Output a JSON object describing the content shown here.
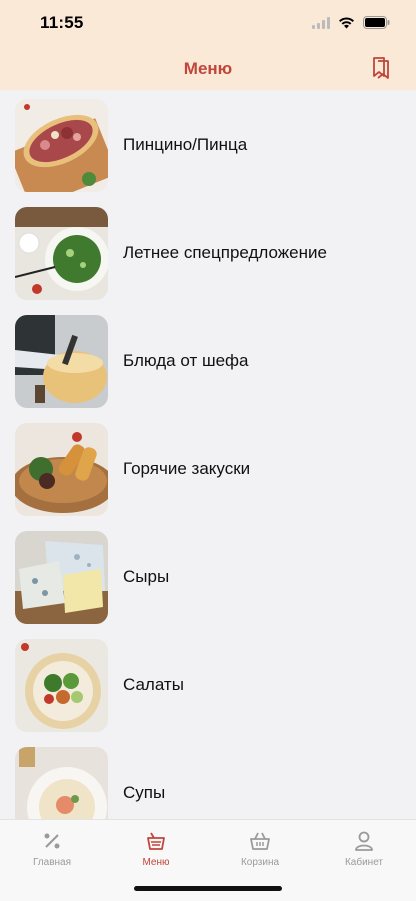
{
  "status": {
    "time": "11:55"
  },
  "header": {
    "title": "Меню"
  },
  "menu": {
    "items": [
      {
        "label": "Пинцино/Пинца"
      },
      {
        "label": "Летнее спецпредложение"
      },
      {
        "label": "Блюда от шефа"
      },
      {
        "label": "Горячие закуски"
      },
      {
        "label": "Сыры"
      },
      {
        "label": "Салаты"
      },
      {
        "label": "Супы"
      }
    ]
  },
  "tabs": [
    {
      "label": "Главная",
      "icon": "percent-icon"
    },
    {
      "label": "Меню",
      "icon": "menu-pot-icon",
      "active": true
    },
    {
      "label": "Корзина",
      "icon": "basket-icon"
    },
    {
      "label": "Кабинет",
      "icon": "profile-icon"
    }
  ],
  "colors": {
    "accent": "#c0463b",
    "header_bg": "#fbe9d8",
    "list_bg": "#f2f2f4",
    "tab_inactive": "#9a9a9a"
  }
}
